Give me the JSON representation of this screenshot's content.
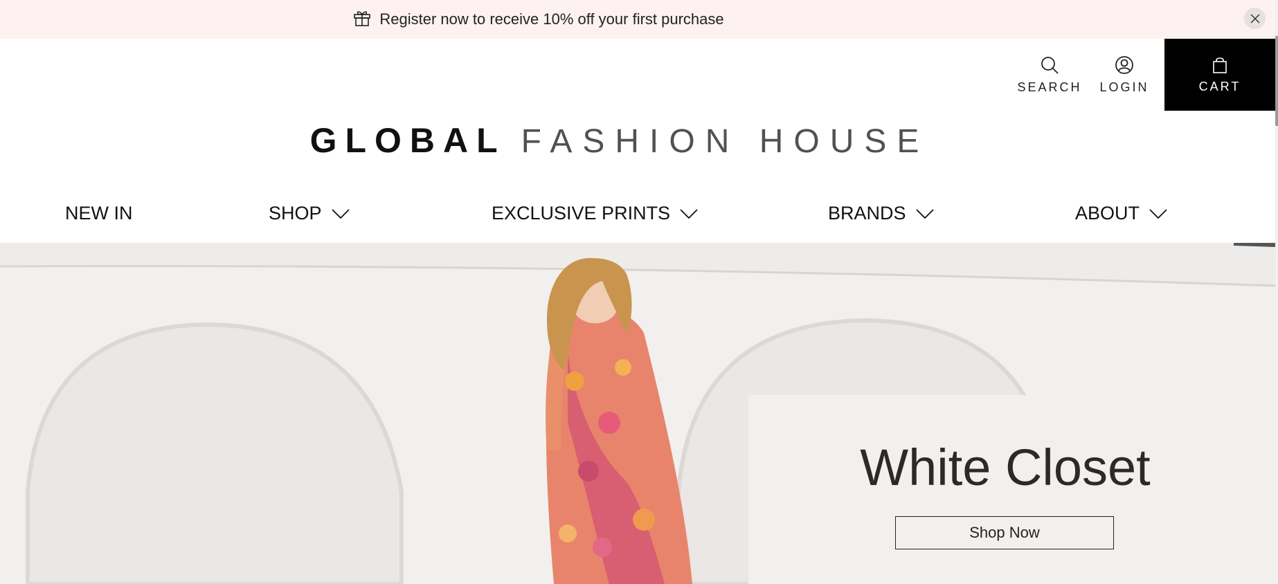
{
  "promo": {
    "text": "Register now to receive 10% off your first purchase",
    "icon": "gift-icon",
    "close_icon": "close-icon"
  },
  "header": {
    "search_label": "SEARCH",
    "login_label": "LOGIN",
    "cart_label": "CART",
    "logo_bold": "GLOBAL",
    "logo_light": "FASHION HOUSE"
  },
  "nav": {
    "items": [
      {
        "label": "NEW IN",
        "has_dropdown": false
      },
      {
        "label": "SHOP",
        "has_dropdown": true
      },
      {
        "label": "EXCLUSIVE PRINTS",
        "has_dropdown": true
      },
      {
        "label": "BRANDS",
        "has_dropdown": true
      },
      {
        "label": "ABOUT",
        "has_dropdown": true
      }
    ]
  },
  "hero": {
    "title": "White Closet",
    "cta_label": "Shop Now"
  },
  "colors": {
    "promo_bg": "#fdf1f1",
    "cart_bg": "#000000",
    "hero_bg": "#efedeb"
  }
}
